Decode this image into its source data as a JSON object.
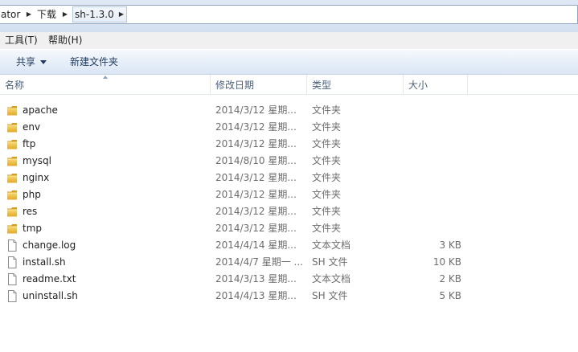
{
  "breadcrumb": {
    "items": [
      "ator",
      "下载",
      "sh-1.3.0"
    ]
  },
  "menu": {
    "items": [
      "工具(T)",
      "帮助(H)"
    ]
  },
  "toolbar": {
    "share_label": "共享",
    "new_folder_label": "新建文件夹"
  },
  "columns": {
    "name": "名称",
    "modified": "修改日期",
    "type": "类型",
    "size": "大小"
  },
  "files": [
    {
      "name": "apache",
      "modified": "2014/3/12 星期...",
      "type": "文件夹",
      "size": "",
      "icon": "folder-icon"
    },
    {
      "name": "env",
      "modified": "2014/3/12 星期...",
      "type": "文件夹",
      "size": "",
      "icon": "folder-icon"
    },
    {
      "name": "ftp",
      "modified": "2014/3/12 星期...",
      "type": "文件夹",
      "size": "",
      "icon": "folder-icon"
    },
    {
      "name": "mysql",
      "modified": "2014/8/10 星期...",
      "type": "文件夹",
      "size": "",
      "icon": "folder-icon"
    },
    {
      "name": "nginx",
      "modified": "2014/3/12 星期...",
      "type": "文件夹",
      "size": "",
      "icon": "folder-icon"
    },
    {
      "name": "php",
      "modified": "2014/3/12 星期...",
      "type": "文件夹",
      "size": "",
      "icon": "folder-icon"
    },
    {
      "name": "res",
      "modified": "2014/3/12 星期...",
      "type": "文件夹",
      "size": "",
      "icon": "folder-icon"
    },
    {
      "name": "tmp",
      "modified": "2014/3/12 星期...",
      "type": "文件夹",
      "size": "",
      "icon": "folder-icon"
    },
    {
      "name": "change.log",
      "modified": "2014/4/14 星期...",
      "type": "文本文档",
      "size": "3 KB",
      "icon": "file-icon"
    },
    {
      "name": "install.sh",
      "modified": "2014/4/7 星期一 ...",
      "type": "SH 文件",
      "size": "10 KB",
      "icon": "file-icon"
    },
    {
      "name": "readme.txt",
      "modified": "2014/3/13 星期...",
      "type": "文本文档",
      "size": "2 KB",
      "icon": "file-icon"
    },
    {
      "name": "uninstall.sh",
      "modified": "2014/4/13 星期...",
      "type": "SH 文件",
      "size": "5 KB",
      "icon": "file-icon"
    }
  ],
  "colors": {
    "folder": "#e8b93c",
    "header_text": "#4c607a",
    "secondary_text": "#6d6d6d"
  }
}
